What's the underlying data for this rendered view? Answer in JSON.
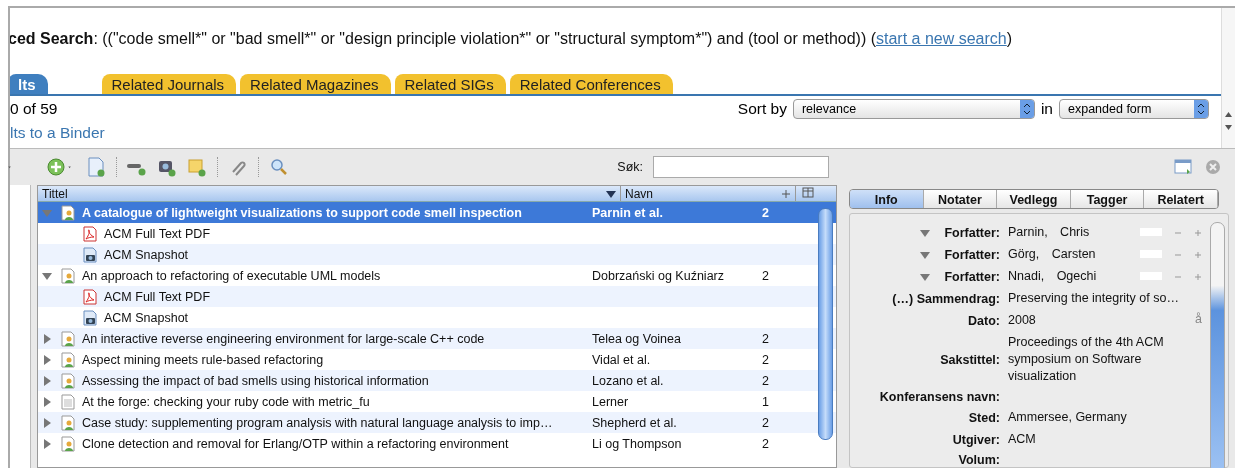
{
  "search": {
    "title": "**ced Search**: ((\"code smell*\" or \"bad smell*\" or \"design principle violation*\" or \"structural symptom*\") and (tool or method))  (",
    "link": "start a new search",
    "close": ")"
  },
  "tabs": [
    {
      "label": "lts",
      "selected": true
    },
    {
      "label": "Related Journals",
      "selected": false
    },
    {
      "label": "Related Magazines",
      "selected": false
    },
    {
      "label": "Related SIGs",
      "selected": false
    },
    {
      "label": "Related Conferences",
      "selected": false
    }
  ],
  "result_count": "0 of 59",
  "sort": {
    "label": "Sort by",
    "value": "relevance",
    "joiner": "in",
    "form": "expanded form"
  },
  "binder_link": "lts to a Binder",
  "zotero": {
    "search_label": "Søk:",
    "columns": [
      "Tittel",
      "Navn"
    ],
    "rows": [
      {
        "kind": "conference",
        "title": "A catalogue of lightweight visualizations to support code smell inspection",
        "author": "Parnin et al.",
        "count": "2",
        "selected": true,
        "expanded": true,
        "children": [
          {
            "kind": "pdf",
            "title": "ACM Full Text PDF"
          },
          {
            "kind": "snapshot",
            "title": "ACM Snapshot"
          }
        ]
      },
      {
        "kind": "conference",
        "title": "An approach to refactoring of executable UML models",
        "author": "Dobrzański og Kuźniarz",
        "count": "2",
        "selected": false,
        "expanded": true,
        "children": [
          {
            "kind": "pdf",
            "title": "ACM Full Text PDF"
          },
          {
            "kind": "snapshot",
            "title": "ACM Snapshot"
          }
        ]
      },
      {
        "kind": "conference",
        "title": "An interactive reverse engineering environment for large-scale C++ code",
        "author": "Telea og Voinea",
        "count": "2",
        "selected": false,
        "expanded": false
      },
      {
        "kind": "conference",
        "title": "Aspect mining meets rule-based refactoring",
        "author": "Vidal et al.",
        "count": "2",
        "selected": false,
        "expanded": false
      },
      {
        "kind": "conference",
        "title": "Assessing the impact of bad smells using historical information",
        "author": "Lozano et al.",
        "count": "2",
        "selected": false,
        "expanded": false
      },
      {
        "kind": "document",
        "title": "At the forge: checking your ruby code with metric_fu",
        "author": "Lerner",
        "count": "1",
        "selected": false,
        "expanded": false
      },
      {
        "kind": "conference",
        "title": "Case study: supplementing program analysis with natural language analysis to imp…",
        "author": "Shepherd et al.",
        "count": "2",
        "selected": false,
        "expanded": false
      },
      {
        "kind": "conference",
        "title": "Clone detection and removal for Erlang/OTP within a refactoring environment",
        "author": "Li og Thompson",
        "count": "2",
        "selected": false,
        "expanded": false
      }
    ],
    "pane_tabs": [
      {
        "label": "Info",
        "selected": true
      },
      {
        "label": "Notater",
        "selected": false
      },
      {
        "label": "Vedlegg",
        "selected": false
      },
      {
        "label": "Tagger",
        "selected": false
      },
      {
        "label": "Relatert",
        "selected": false
      }
    ],
    "fields": [
      {
        "kind": "creator",
        "label": "Forfatter:",
        "last": "Parnin,",
        "first": "Chris"
      },
      {
        "kind": "creator",
        "label": "Forfatter:",
        "last": "Görg,",
        "first": "Carsten"
      },
      {
        "kind": "creator",
        "label": "Forfatter:",
        "last": "Nnadi,",
        "first": "Ogechi"
      },
      {
        "kind": "field",
        "label": "(…) Sammendrag:",
        "value": "Preserving the integrity of so…"
      },
      {
        "kind": "field",
        "label": "Dato:",
        "value": "2008",
        "extra": "å"
      },
      {
        "kind": "field",
        "label": "Sakstittel:",
        "value": "Proceedings of the 4th ACM symposium on Software visualization"
      },
      {
        "kind": "field",
        "label": "Konferansens navn:"
      },
      {
        "kind": "field",
        "label": "Sted:",
        "value": "Ammersee, Germany"
      },
      {
        "kind": "field",
        "label": "Utgiver:",
        "value": "ACM"
      },
      {
        "kind": "field",
        "label": "Volum:"
      }
    ]
  }
}
